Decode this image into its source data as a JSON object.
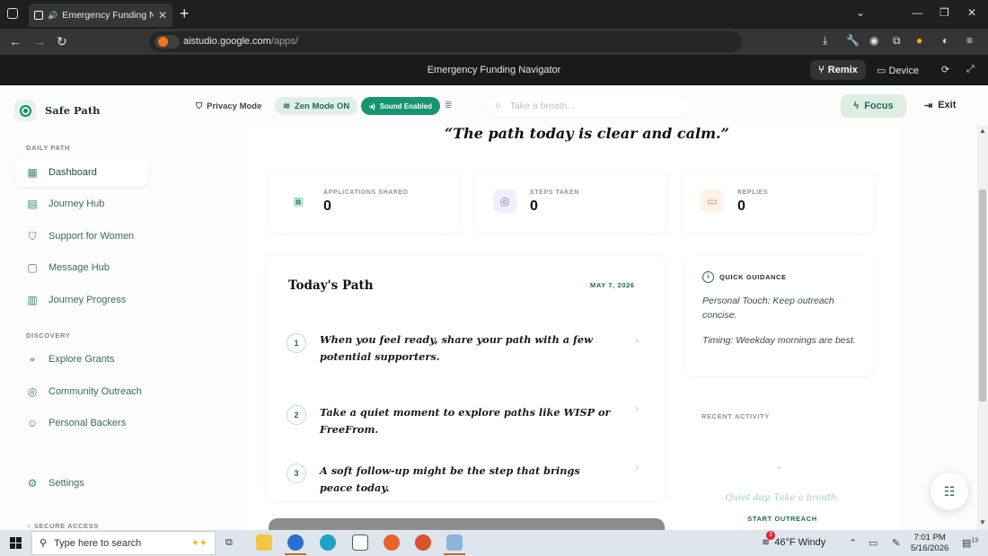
{
  "browser": {
    "tab_title": "Emergency Funding Navigat",
    "url_domain": "aistudio.google.com",
    "url_path": "/apps/",
    "new_tab": "+",
    "tab_close": "✕"
  },
  "studio": {
    "title": "Emergency Funding Navigator",
    "remix_label": "Remix",
    "device_label": "Device"
  },
  "app": {
    "brand": "Safe Path",
    "sections": {
      "daily": "DAILY PATH",
      "discovery": "DISCOVERY",
      "secure": "SECURE ACCESS"
    },
    "nav": [
      {
        "label": "Dashboard",
        "icon": "grid-icon"
      },
      {
        "label": "Journey Hub",
        "icon": "clipboard-icon"
      },
      {
        "label": "Support for Women",
        "icon": "shield-icon"
      },
      {
        "label": "Message Hub",
        "icon": "message-icon"
      },
      {
        "label": "Journey Progress",
        "icon": "bar-chart-icon"
      }
    ],
    "discovery_nav": [
      {
        "label": "Explore Grants",
        "icon": "pin-icon"
      },
      {
        "label": "Community Outreach",
        "icon": "target-icon"
      },
      {
        "label": "Personal Backers",
        "icon": "users-icon"
      }
    ],
    "settings_label": "Settings"
  },
  "topbar": {
    "privacy": "Privacy Mode",
    "zen": "Zen Mode ON",
    "sound": "Sound Enabled",
    "search_placeholder": "Take a breath...",
    "focus": "Focus",
    "exit": "Exit"
  },
  "main": {
    "quote": "“The path today is clear and calm.”",
    "stats": [
      {
        "label": "APPLICATIONS SHARED",
        "value": "0"
      },
      {
        "label": "STEPS TAKEN",
        "value": "0"
      },
      {
        "label": "REPLIES",
        "value": "0"
      }
    ],
    "path": {
      "title": "Today's Path",
      "date": "MAY 7, 2026",
      "steps": [
        {
          "num": "1",
          "text": "When you feel ready, share your path with a few potential supporters."
        },
        {
          "num": "2",
          "text": "Take a quiet moment to explore paths like WISP or FreeFrom."
        },
        {
          "num": "3",
          "text": "A soft follow-up might be the step that brings peace today."
        }
      ]
    },
    "guidance": {
      "title": "QUICK GUIDANCE",
      "items": [
        "Personal Touch: Keep outreach concise.",
        "Timing: Weekday mornings are best."
      ]
    },
    "activity": {
      "title": "RECENT ACTIVITY",
      "empty": "Quiet day. Take a breath.",
      "cta": "START OUTREACH"
    }
  },
  "taskbar": {
    "search_placeholder": "Type here to search",
    "weather": "46°F  Windy",
    "time": "7:01 PM",
    "date": "5/16/2026",
    "notif_count": "3",
    "tray_count": "13"
  },
  "colors": {
    "accent": "#15966f",
    "accent_dark": "#1f6b51",
    "background": "#fbfcfb"
  }
}
